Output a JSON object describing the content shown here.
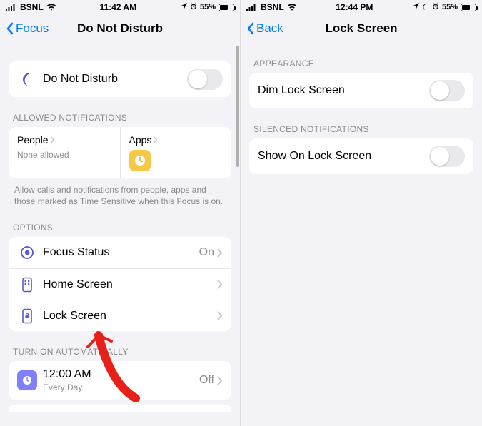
{
  "left": {
    "status": {
      "carrier": "BSNL",
      "time": "11:42 AM",
      "battery": "55%"
    },
    "nav": {
      "back": "Focus",
      "title": "Do Not Disturb"
    },
    "dnd_row": {
      "label": "Do Not Disturb"
    },
    "allowed_header": "ALLOWED NOTIFICATIONS",
    "allowed": {
      "people": {
        "title": "People",
        "sub": "None allowed"
      },
      "apps": {
        "title": "Apps"
      }
    },
    "allowed_footer": "Allow calls and notifications from people, apps and those marked as Time Sensitive when this Focus is on.",
    "options_header": "OPTIONS",
    "options": {
      "focus_status": {
        "label": "Focus Status",
        "value": "On"
      },
      "home_screen": {
        "label": "Home Screen"
      },
      "lock_screen": {
        "label": "Lock Screen"
      }
    },
    "auto_header": "TURN ON AUTOMATICALLY",
    "auto": {
      "time": "12:00 AM",
      "repeat": "Every Day",
      "state": "Off"
    }
  },
  "right": {
    "status": {
      "carrier": "BSNL",
      "time": "12:44 PM",
      "battery": "55%"
    },
    "nav": {
      "back": "Back",
      "title": "Lock Screen"
    },
    "appearance_header": "APPEARANCE",
    "dim_row": {
      "label": "Dim Lock Screen"
    },
    "silenced_header": "SILENCED NOTIFICATIONS",
    "show_row": {
      "label": "Show On Lock Screen"
    }
  }
}
